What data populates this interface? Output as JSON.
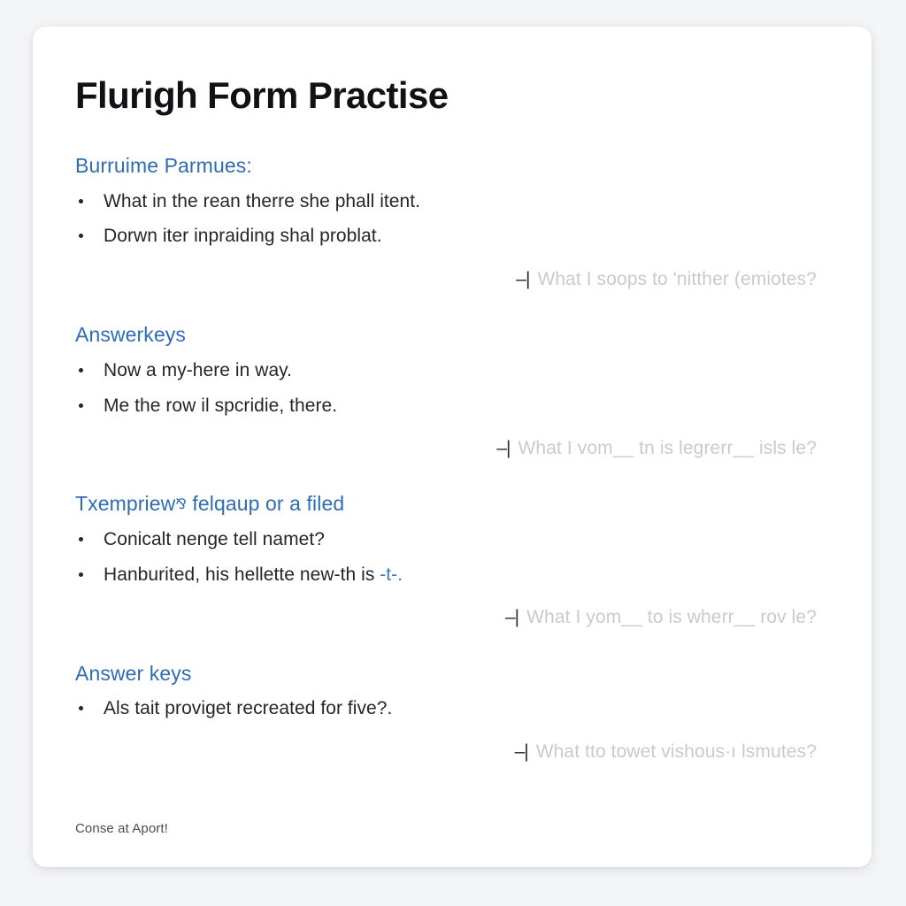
{
  "document": {
    "title": "Flurigh Form Practise",
    "footer_note": "Conse at Aport!"
  },
  "sections": [
    {
      "heading": "Burruime Parmues:",
      "heading_marker": "",
      "bullets": [
        {
          "text": "What in the rean therre she phall itent."
        },
        {
          "text": "Dorwn iter inpraiding shal problat."
        }
      ],
      "ghost": {
        "caret": "–|",
        "text": "What I soops to 'nitther (emiotes?"
      }
    },
    {
      "heading": "Answerkeys",
      "heading_marker": "",
      "bullets": [
        {
          "text": "Now a my-here in way."
        },
        {
          "text": "Me the row il spcridie, there."
        }
      ],
      "ghost": {
        "caret": "–|",
        "text": "What I vom__ tn is legrerr__ isls le?"
      }
    },
    {
      "heading_pre": "Txempriew",
      "heading_marker": "⅋",
      "heading_post": "felqaup or a filed",
      "heading": "Txempriew ⅋ felqaup or a filed",
      "bullets": [
        {
          "text": "Conicalt nenge tell namet?"
        },
        {
          "text": "Hanburited, his hellette new-th is ",
          "link_text": "-t-."
        }
      ],
      "ghost": {
        "caret": "–|",
        "text": "What I yom__ to is wherr__ rov le?"
      }
    },
    {
      "heading": "Answer keys",
      "heading_marker": "",
      "bullets": [
        {
          "text": "Als tait proviget recreated for five?."
        }
      ],
      "ghost": {
        "caret": "–|",
        "text": "What tto towet vishous·ı lsmutes?"
      }
    }
  ],
  "colors": {
    "page_background": "#f4f5f7",
    "card_background": "#ffffff",
    "heading_blue": "#2f6cb3",
    "body_text": "#24262b",
    "ghost_text": "#c8cacd",
    "link_blue": "#3b7cc4"
  }
}
